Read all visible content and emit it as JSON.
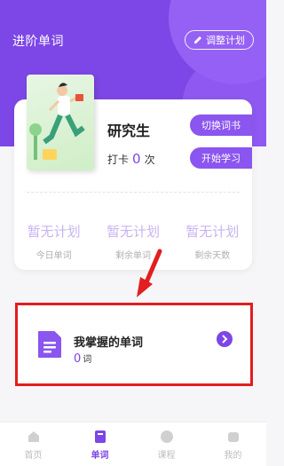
{
  "header": {
    "title": "进阶单词",
    "adjust_plan": "调整计划"
  },
  "book": {
    "name": "研究生",
    "checkin_label": "打卡",
    "checkin_count": "0",
    "checkin_unit": "次",
    "switch_book": "切换词书",
    "start_learning": "开始学习"
  },
  "stats": [
    {
      "value": "暂无计划",
      "label": "今日单词"
    },
    {
      "value": "暂无计划",
      "label": "剩余单词"
    },
    {
      "value": "暂无计划",
      "label": "剩余天数"
    }
  ],
  "mastered": {
    "title": "我掌握的单词",
    "count": "0",
    "unit": "词"
  },
  "nav": [
    {
      "label": "首页",
      "icon": "home-icon"
    },
    {
      "label": "单词",
      "icon": "book-icon"
    },
    {
      "label": "课程",
      "icon": "course-icon"
    },
    {
      "label": "我的",
      "icon": "profile-icon"
    }
  ],
  "colors": {
    "accent": "#7d46e6",
    "annotation": "#e21e1e"
  }
}
